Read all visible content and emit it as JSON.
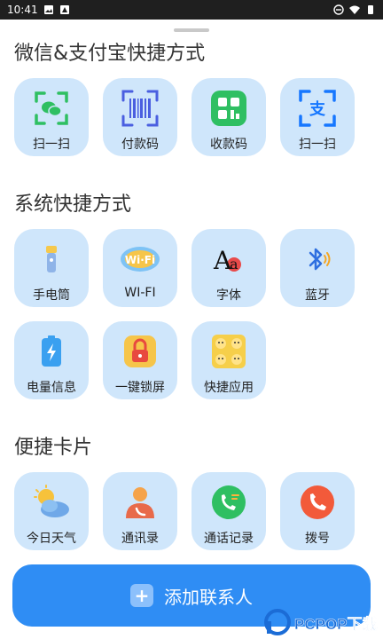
{
  "status_bar": {
    "time": "10:41"
  },
  "sections": [
    {
      "title": "微信&支付宝快捷方式",
      "tiles": [
        {
          "label": "扫一扫",
          "icon": "wechat-scan-icon"
        },
        {
          "label": "付款码",
          "icon": "barcode-icon"
        },
        {
          "label": "收款码",
          "icon": "qr-code-icon"
        },
        {
          "label": "扫一扫",
          "icon": "alipay-scan-icon"
        }
      ]
    },
    {
      "title": "系统快捷方式",
      "tiles": [
        {
          "label": "手电筒",
          "icon": "flashlight-icon"
        },
        {
          "label": "WI-FI",
          "icon": "wifi-icon"
        },
        {
          "label": "字体",
          "icon": "font-icon"
        },
        {
          "label": "蓝牙",
          "icon": "bluetooth-icon"
        },
        {
          "label": "电量信息",
          "icon": "battery-icon"
        },
        {
          "label": "一键锁屏",
          "icon": "lock-icon"
        },
        {
          "label": "快捷应用",
          "icon": "apps-icon"
        }
      ]
    },
    {
      "title": "便捷卡片",
      "tiles": [
        {
          "label": "今日天气",
          "icon": "weather-icon"
        },
        {
          "label": "通讯录",
          "icon": "contacts-icon"
        },
        {
          "label": "通话记录",
          "icon": "call-log-icon"
        },
        {
          "label": "拨号",
          "icon": "dial-icon"
        }
      ]
    }
  ],
  "add_contact": {
    "label": "添加联系人"
  },
  "watermark": {
    "text": "PCPOP下载"
  }
}
